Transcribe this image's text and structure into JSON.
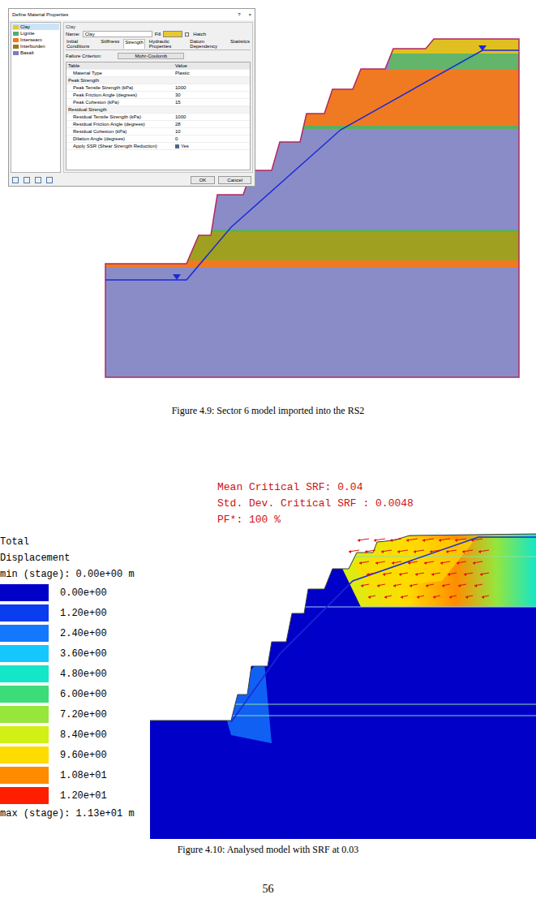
{
  "figure_4_9": {
    "dialog": {
      "title": "Define Material Properties",
      "help": "?",
      "close": "×",
      "materials": [
        {
          "name": "Clay",
          "color": "#e8c830",
          "selected": true
        },
        {
          "name": "Lignite",
          "color": "#4caf74",
          "selected": false
        },
        {
          "name": "Interseam",
          "color": "#f07820",
          "selected": false
        },
        {
          "name": "Interburden",
          "color": "#a07818",
          "selected": false
        },
        {
          "name": "Basalt",
          "color": "#7b7fc0",
          "selected": false
        }
      ],
      "group": "Clay",
      "name_label": "Name:",
      "name_value": "Clay",
      "fill_label": "Fill",
      "hatch": {
        "label": "Hatch",
        "checked": false
      },
      "tabs": [
        {
          "label": "Initial Conditions",
          "selected": false
        },
        {
          "label": "Stiffness",
          "selected": false
        },
        {
          "label": "Strength",
          "selected": true
        },
        {
          "label": "Hydraulic Properties",
          "selected": false
        },
        {
          "label": "Datum Dependency",
          "selected": false
        },
        {
          "label": "Statistics",
          "selected": false
        }
      ],
      "criterion_label": "Failure Criterion:",
      "criterion_value": "Mohr-Coulomb",
      "columns": [
        "Table",
        "Value"
      ],
      "rows": [
        {
          "kind": "row",
          "label": "Material Type",
          "value": "Plastic"
        },
        {
          "kind": "section",
          "label": "Peak Strength",
          "value": ""
        },
        {
          "kind": "row",
          "label": "Peak Tensile Strength (kPa)",
          "value": "1000"
        },
        {
          "kind": "row",
          "label": "Peak Friction Angle (degrees)",
          "value": "30"
        },
        {
          "kind": "row",
          "label": "Peak Cohesion (kPa)",
          "value": "15"
        },
        {
          "kind": "section",
          "label": "Residual Strength",
          "value": ""
        },
        {
          "kind": "row",
          "label": "Residual Tensile Strength (kPa)",
          "value": "1000"
        },
        {
          "kind": "row",
          "label": "Residual Friction Angle (degrees)",
          "value": "28"
        },
        {
          "kind": "row",
          "label": "Residual Cohesion (kPa)",
          "value": "10"
        },
        {
          "kind": "row",
          "label": "Dilation Angle (degrees)",
          "value": "0"
        },
        {
          "kind": "check",
          "label": "Apply SSR (Shear Strength Reduction)",
          "value": "Yes",
          "checked": true
        }
      ],
      "buttons": [
        "OK",
        "Cancel"
      ]
    },
    "caption": "Figure 4.9:  Sector 6 model imported into the RS2"
  },
  "figure_4_10": {
    "results": [
      "Mean Critical SRF: 0.04",
      "Std. Dev. Critical SRF : 0.0048",
      "PF*: 100 %"
    ],
    "legend": {
      "title": [
        "Total",
        "Displacement"
      ],
      "min": "min (stage): 0.00e+00 m",
      "max": "max (stage): 1.13e+01 m",
      "entries": [
        {
          "value": "0.00e+00",
          "color": "#0000c8"
        },
        {
          "value": "1.20e+00",
          "color": "#0a3cf0"
        },
        {
          "value": "2.40e+00",
          "color": "#1478ff"
        },
        {
          "value": "3.60e+00",
          "color": "#14c8ff"
        },
        {
          "value": "4.80e+00",
          "color": "#14e6c8"
        },
        {
          "value": "6.00e+00",
          "color": "#3cdc78"
        },
        {
          "value": "7.20e+00",
          "color": "#96e63c"
        },
        {
          "value": "8.40e+00",
          "color": "#d2f014"
        },
        {
          "value": "9.60e+00",
          "color": "#ffdc00"
        },
        {
          "value": "1.08e+01",
          "color": "#ff8c00"
        },
        {
          "value": "1.20e+01",
          "color": "#ff1e00"
        }
      ]
    },
    "caption": "Figure 4.10:  Analysed model with SRF at 0.03"
  },
  "page_number": "56"
}
